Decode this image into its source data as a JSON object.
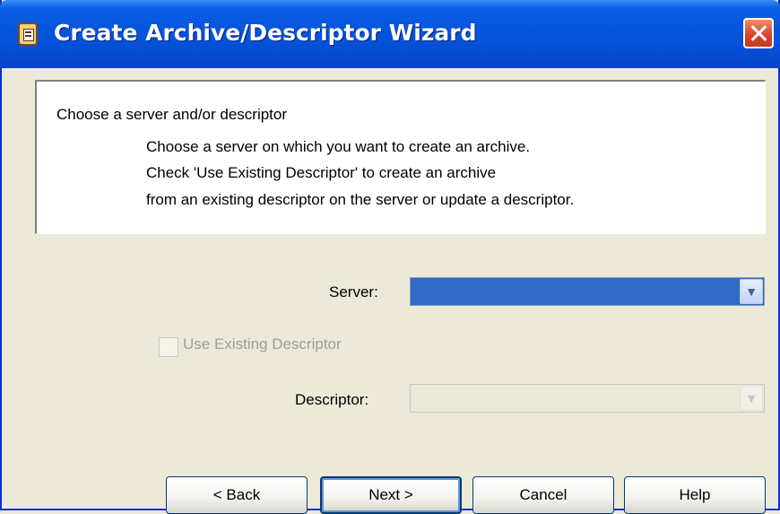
{
  "window": {
    "title": "Create Archive/Descriptor Wizard",
    "title_icon": "archive-wizard-icon",
    "close_icon": "close-icon"
  },
  "header": {
    "title": "Choose a server and/or descriptor",
    "lines": [
      "Choose a server on which you want to create an archive.",
      "Check 'Use Existing Descriptor' to create an archive",
      "from an existing descriptor on the server or update a descriptor."
    ]
  },
  "form": {
    "server_label": "Server:",
    "server_value": "",
    "use_existing_label": "Use Existing Descriptor",
    "use_existing_checked": false,
    "descriptor_label": "Descriptor:",
    "descriptor_value": ""
  },
  "buttons": {
    "back": "< Back",
    "next": "Next >",
    "cancel": "Cancel",
    "help": "Help"
  },
  "colors": {
    "titlebar": "#0655dc",
    "window_bg": "#ece9d8",
    "selection": "#316ac5",
    "disabled_text": "#a19f92"
  }
}
